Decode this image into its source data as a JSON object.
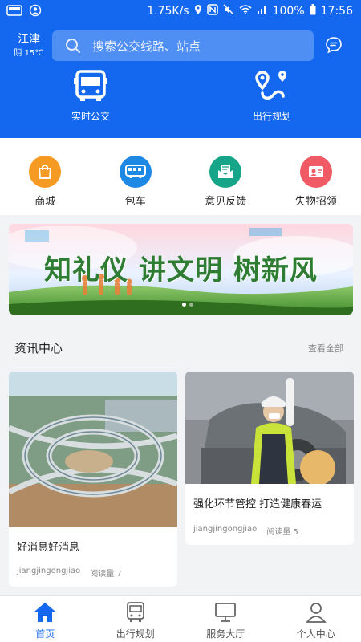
{
  "status_bar": {
    "speed": "1.75K/s",
    "battery": "100%",
    "time": "17:56"
  },
  "location": {
    "city": "江津",
    "weather": "阴 15℃"
  },
  "search": {
    "placeholder": "搜索公交线路、站点"
  },
  "header_actions": [
    {
      "label": "实时公交",
      "icon": "bus-icon"
    },
    {
      "label": "出行规划",
      "icon": "route-planning-icon"
    }
  ],
  "services": [
    {
      "label": "商城",
      "icon": "shopping-bag-icon",
      "color": "#f59a23"
    },
    {
      "label": "包车",
      "icon": "bus-charter-icon",
      "color": "#1e88e5"
    },
    {
      "label": "意见反馈",
      "icon": "feedback-icon",
      "color": "#17a589"
    },
    {
      "label": "失物招领",
      "icon": "lost-found-icon",
      "color": "#ef5a64"
    }
  ],
  "banner": {
    "slogan": "知礼仪 讲文明 树新风",
    "slide_count": 2,
    "active_slide": 1
  },
  "news": {
    "title": "资讯中心",
    "view_all": "查看全部",
    "items": [
      {
        "title": "好消息好消息",
        "author": "jiangjingongjiao",
        "reads": "阅读量 7"
      },
      {
        "title": "强化环节管控 打造健康春运",
        "author": "jiangjingongjiao",
        "reads": "阅读量 5"
      }
    ]
  },
  "bottom_nav": [
    {
      "label": "首页",
      "icon": "home-icon",
      "active": true
    },
    {
      "label": "出行规划",
      "icon": "bus-front-icon",
      "active": false
    },
    {
      "label": "服务大厅",
      "icon": "monitor-icon",
      "active": false
    },
    {
      "label": "个人中心",
      "icon": "user-icon",
      "active": false
    }
  ],
  "colors": {
    "primary": "#1468ef",
    "background": "#f2f3f5"
  }
}
